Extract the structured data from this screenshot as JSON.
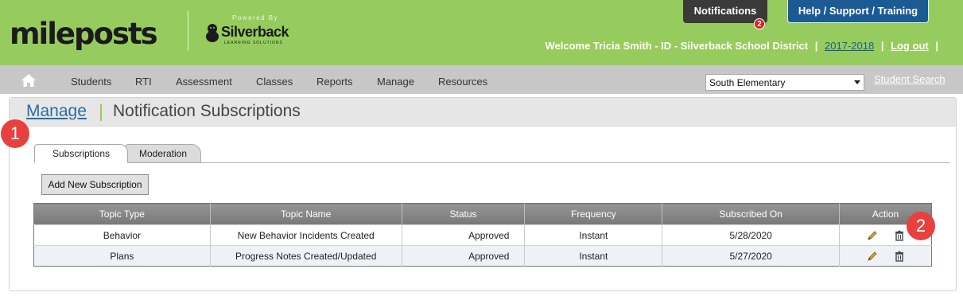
{
  "header": {
    "logo_text": "mileposts",
    "powered_by": "Powered By",
    "partner_name": "Silverback",
    "partner_tagline": "LEARNING SOLUTIONS",
    "notifications_label": "Notifications",
    "notifications_count": "2",
    "help_label": "Help / Support / Training",
    "welcome_text": "Welcome Tricia Smith - ID - Silverback School District",
    "school_year": "2017-2018",
    "logout_label": "Log out",
    "separator": "|"
  },
  "nav": {
    "items": [
      "Students",
      "RTI",
      "Assessment",
      "Classes",
      "Reports",
      "Manage",
      "Resources"
    ],
    "school_selected": "South Elementary",
    "student_search_label": "Student Search"
  },
  "breadcrumb": {
    "parent": "Manage",
    "current": "Notification Subscriptions"
  },
  "tabs": {
    "active": "Subscriptions",
    "inactive": "Moderation"
  },
  "add_button_label": "Add New Subscription",
  "table": {
    "columns": [
      "Topic Type",
      "Topic Name",
      "Status",
      "Frequency",
      "Subscribed On",
      "Action"
    ],
    "rows": [
      {
        "topic_type": "Behavior",
        "topic_name": "New Behavior Incidents Created",
        "status": "Approved",
        "frequency": "Instant",
        "subscribed_on": "5/28/2020"
      },
      {
        "topic_type": "Plans",
        "topic_name": "Progress Notes Created/Updated",
        "status": "Approved",
        "frequency": "Instant",
        "subscribed_on": "5/27/2020"
      }
    ],
    "row_actions": [
      "pencil-icon",
      "trash-icon"
    ]
  },
  "annotations": [
    "1",
    "2"
  ],
  "colors": {
    "header_green": "#96cc5e",
    "nav_gray": "#c7c7c7",
    "help_blue": "#1c5a94",
    "badge_red": "#d9201e",
    "marker_red": "#e8403f"
  }
}
